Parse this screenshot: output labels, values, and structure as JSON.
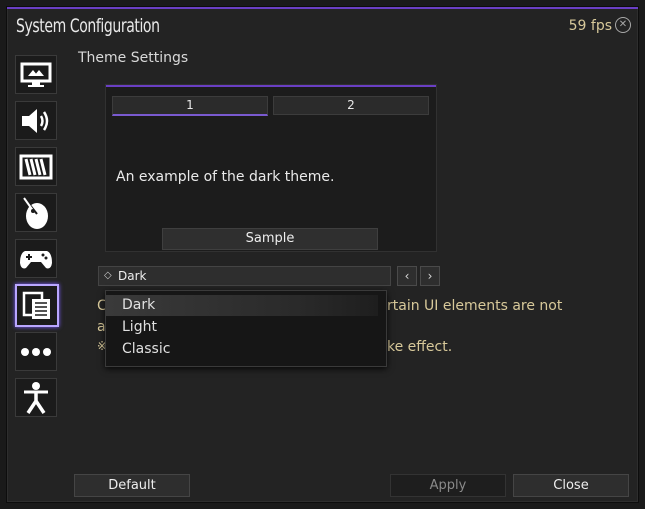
{
  "window": {
    "title": "System Configuration",
    "fps": "59 fps"
  },
  "sidebar": {
    "items": [
      {
        "icon": "display-icon"
      },
      {
        "icon": "speaker-icon"
      },
      {
        "icon": "graphics-icon"
      },
      {
        "icon": "mouse-icon"
      },
      {
        "icon": "gamepad-icon"
      },
      {
        "icon": "document-list-icon",
        "active": true
      },
      {
        "icon": "more-icon"
      },
      {
        "icon": "accessibility-icon"
      }
    ]
  },
  "main": {
    "section_title": "Theme Settings",
    "preview": {
      "tabs": [
        "1",
        "2"
      ],
      "text": "An example of the dark theme.",
      "sample_label": "Sample"
    },
    "theme_select": {
      "value": "Dark",
      "options": [
        "Dark",
        "Light",
        "Classic"
      ]
    },
    "note_fragments": {
      "left1": "C",
      "right1": "rtain UI elements are not",
      "left2": "a",
      "left3": "※",
      "right3": "ke effect."
    }
  },
  "footer": {
    "default_label": "Default",
    "apply_label": "Apply",
    "close_label": "Close"
  },
  "colors": {
    "accent": "#6a3fc4",
    "note": "#d8c99a"
  }
}
